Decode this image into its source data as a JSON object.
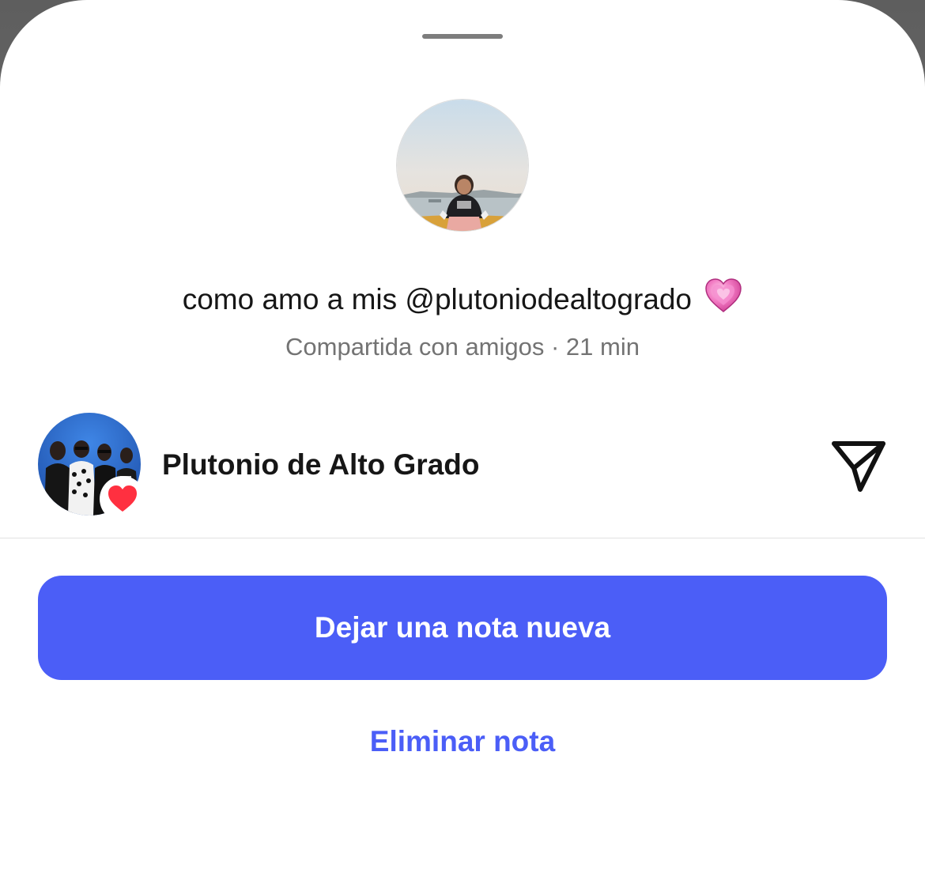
{
  "sheet": {
    "background": "#ffffff",
    "grabber_color": "#7d7d7d"
  },
  "note": {
    "text": "como amo a mis @plutoniodealtogrado",
    "emoji": "💗",
    "meta": "Compartida con amigos · 21 min"
  },
  "song": {
    "title": "Plutonio de Alto Grado",
    "liked": true,
    "icons": {
      "like": "heart-icon",
      "send": "paper-plane-icon"
    }
  },
  "actions": {
    "primary_label": "Dejar una nota nueva",
    "delete_label": "Eliminar nota",
    "accent": "#4b5ef7"
  }
}
